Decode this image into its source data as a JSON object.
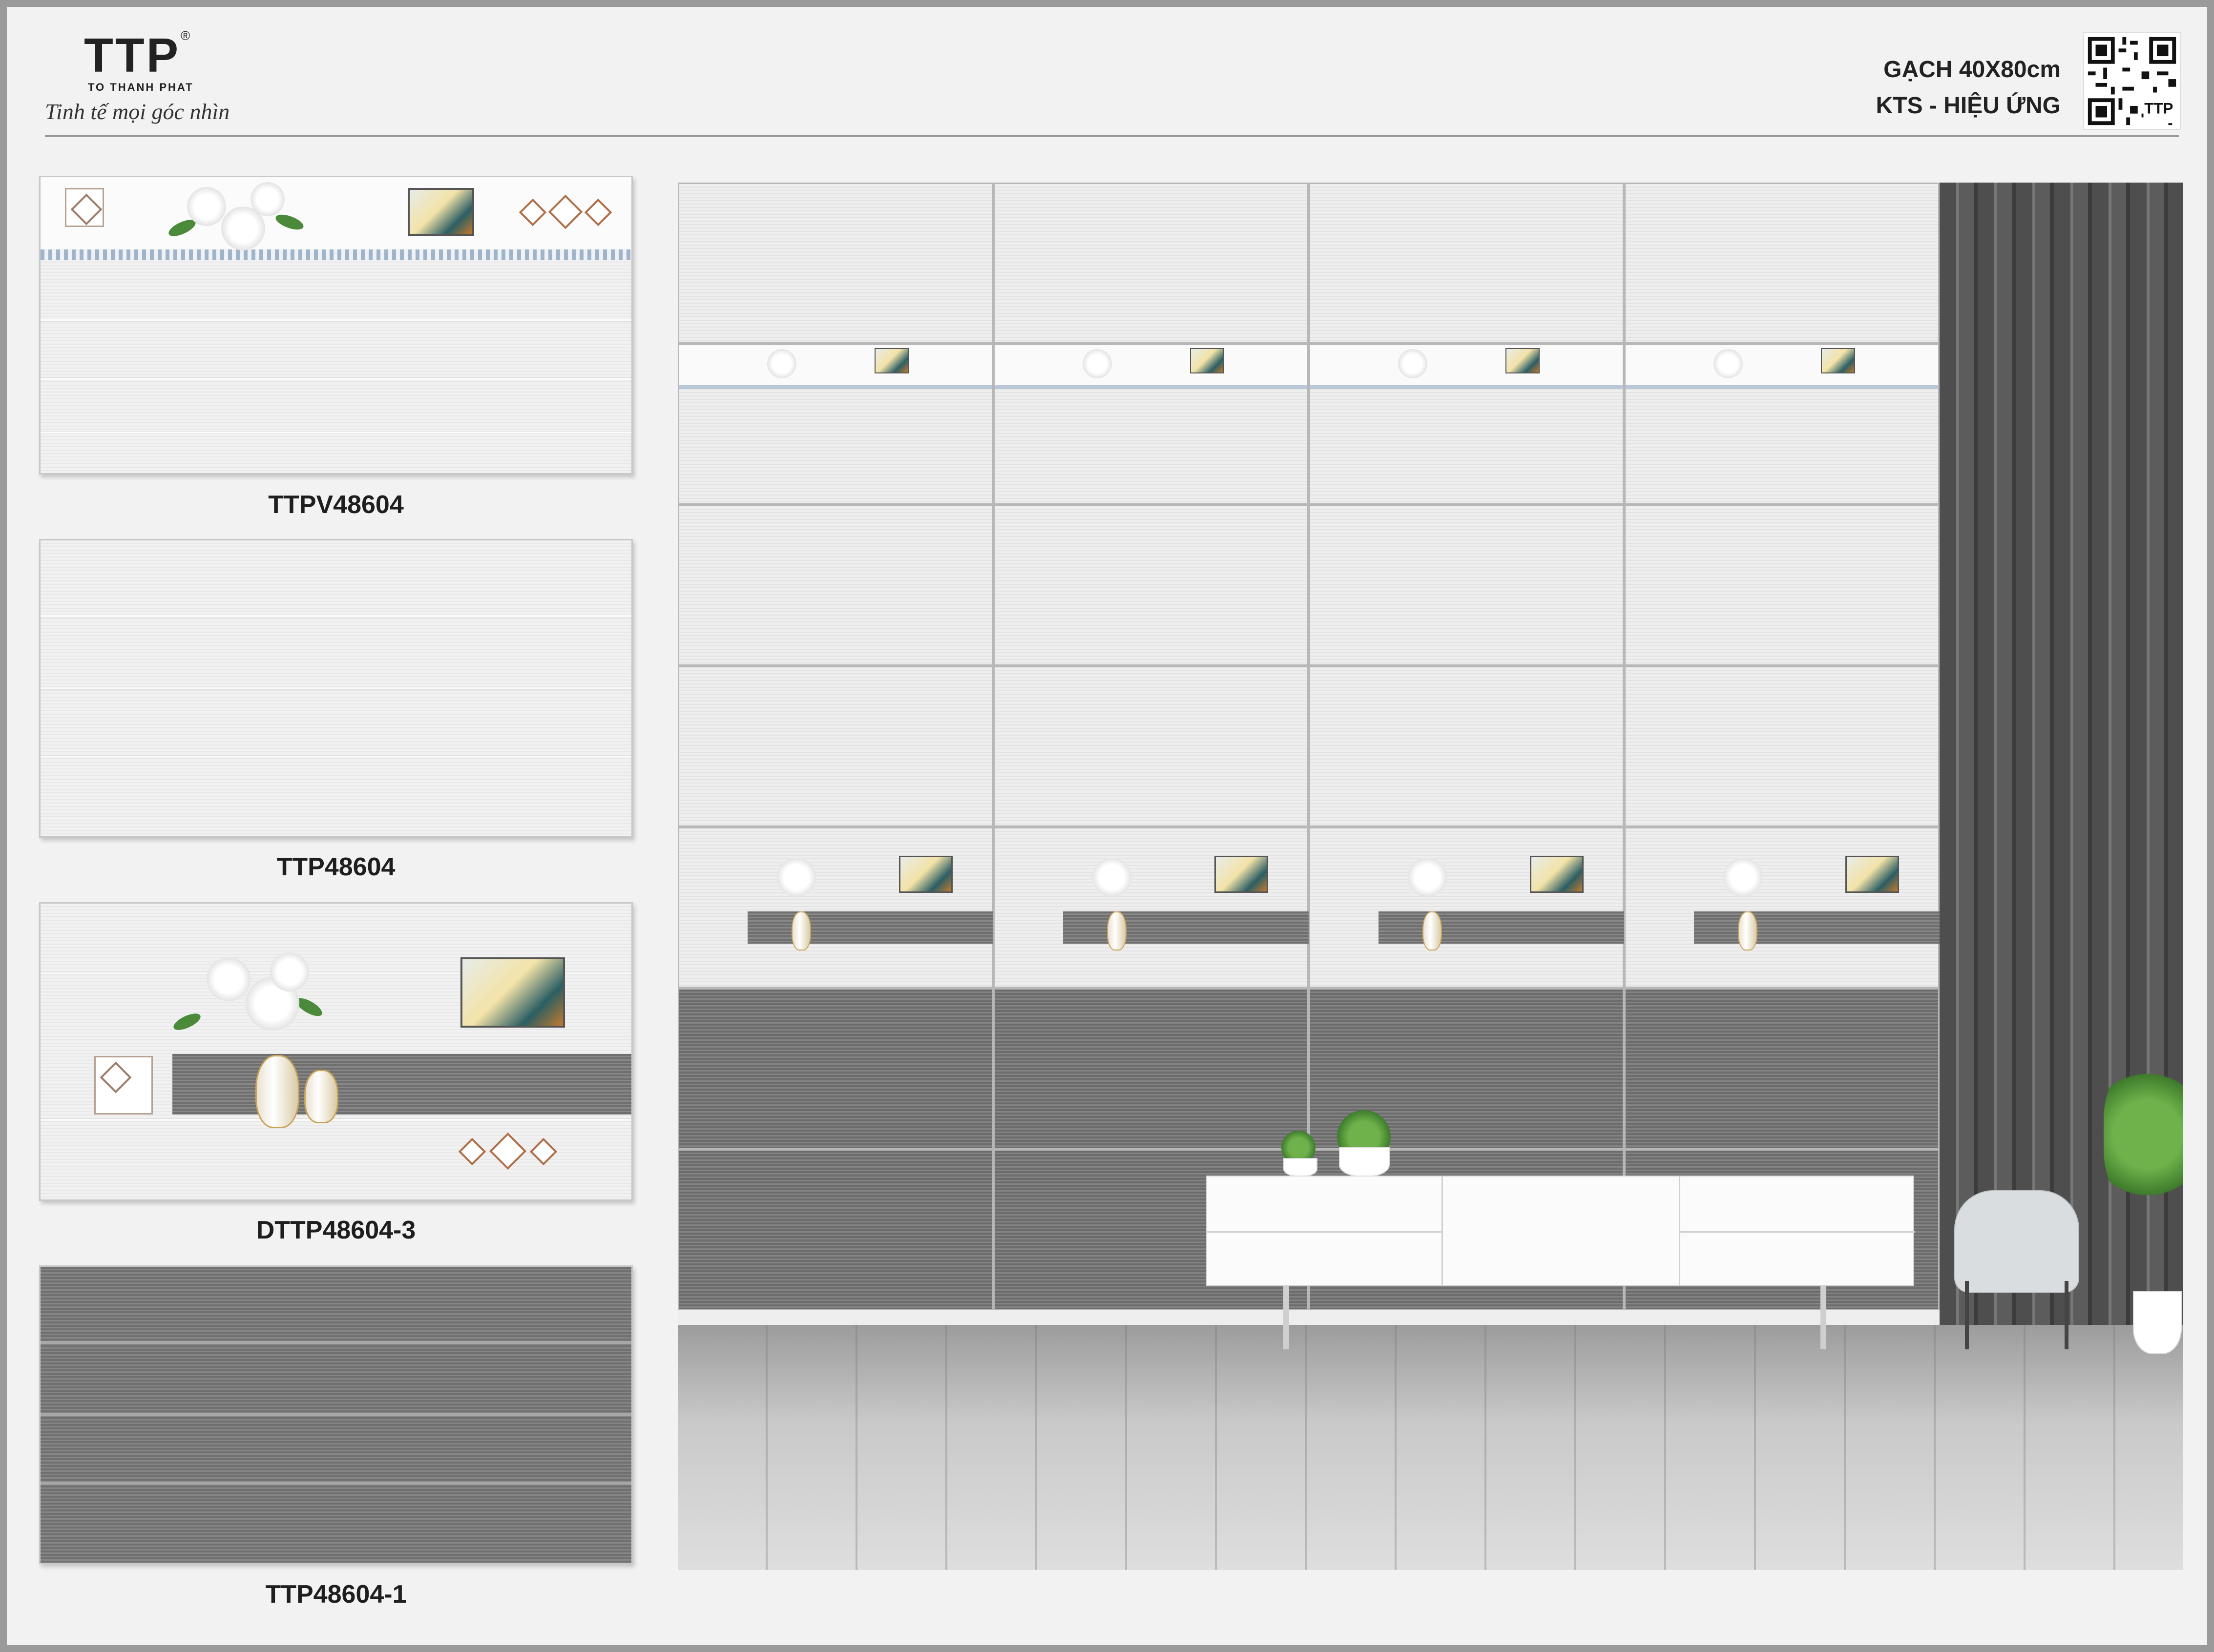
{
  "brand": {
    "logo_text": "TTP",
    "registered": "®",
    "company": "TO THANH PHAT",
    "tagline": "Tinh tế mọi góc nhìn"
  },
  "spec": {
    "line1": "GẠCH 40X80cm",
    "line2": "KTS - HIỆU ỨNG"
  },
  "qr": {
    "icon": "qr-code-icon",
    "logo_text": "TTP"
  },
  "tiles": [
    {
      "code": "TTPV48604",
      "style": "border-flower"
    },
    {
      "code": "TTP48604",
      "style": "plain-light"
    },
    {
      "code": "DTTP48604-3",
      "style": "decor-vase"
    },
    {
      "code": "TTP48604-1",
      "style": "plain-dark"
    }
  ],
  "colors": {
    "light_tile": "#eeeeee",
    "dark_tile": "#787878",
    "caption": "#1e1e1e"
  }
}
